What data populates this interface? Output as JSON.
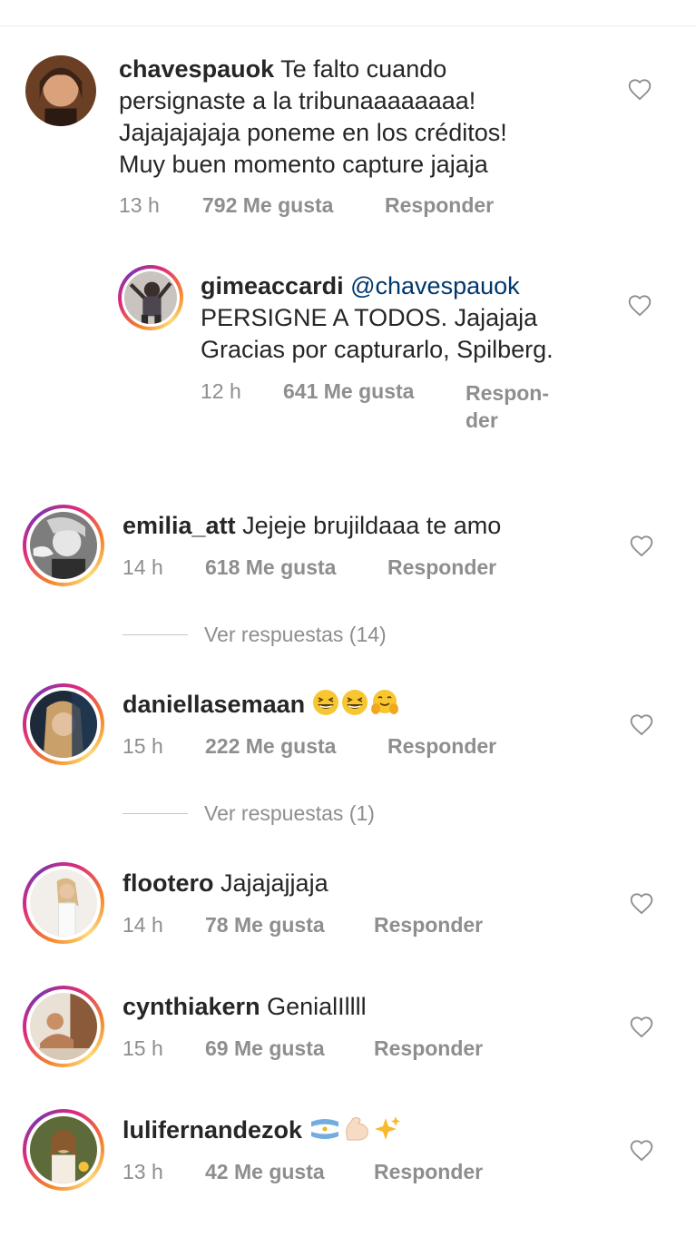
{
  "comments": [
    {
      "username": "chavespauok",
      "text_lines": [
        "Te falto cuando",
        "persignaste a la tribunaaaaaaaa!",
        "Jajajajajaja poneme en los créditos!",
        "Muy buen momento capture jajaja"
      ],
      "time": "13 h",
      "likes": "792 Me gusta",
      "reply": "Responder"
    },
    {
      "username": "gimeaccardi",
      "mention": "@chavespauok",
      "text_lines": [
        "PERSIGNE A TODOS. Jajajaja",
        "Gracias por capturarlo, Spilberg."
      ],
      "time": "12 h",
      "likes": "641 Me gusta",
      "reply_line1": "Respon-",
      "reply_line2": "der"
    },
    {
      "username": "emilia_att",
      "text": "Jejeje brujildaaa te amo",
      "time": "14 h",
      "likes": "618 Me gusta",
      "reply": "Responder",
      "view_replies": "Ver respuestas (14)"
    },
    {
      "username": "daniellasemaan",
      "emojis": [
        "grinning-squint-emoji",
        "grinning-squint-emoji",
        "hugging-face-emoji"
      ],
      "time": "15 h",
      "likes": "222 Me gusta",
      "reply": "Responder",
      "view_replies": "Ver respuestas (1)"
    },
    {
      "username": "flootero",
      "text": "Jajajajjaja",
      "time": "14 h",
      "likes": "78 Me gusta",
      "reply": "Responder"
    },
    {
      "username": "cynthiakern",
      "text": "GenialIllll",
      "time": "15 h",
      "likes": "69 Me gusta",
      "reply": "Responder"
    },
    {
      "username": "lulifernandezok",
      "emojis": [
        "argentina-flag-emoji",
        "flexed-biceps-emoji",
        "sparkles-emoji"
      ],
      "time": "13 h",
      "likes": "42 Me gusta",
      "reply": "Responder"
    }
  ],
  "colors": {
    "text": "#262626",
    "meta": "#8e8e8e",
    "mention": "#00376b",
    "story_ring_start": "#f58529",
    "story_ring_mid": "#dd2a7b"
  },
  "icons": {
    "like": "heart-outline-icon"
  }
}
